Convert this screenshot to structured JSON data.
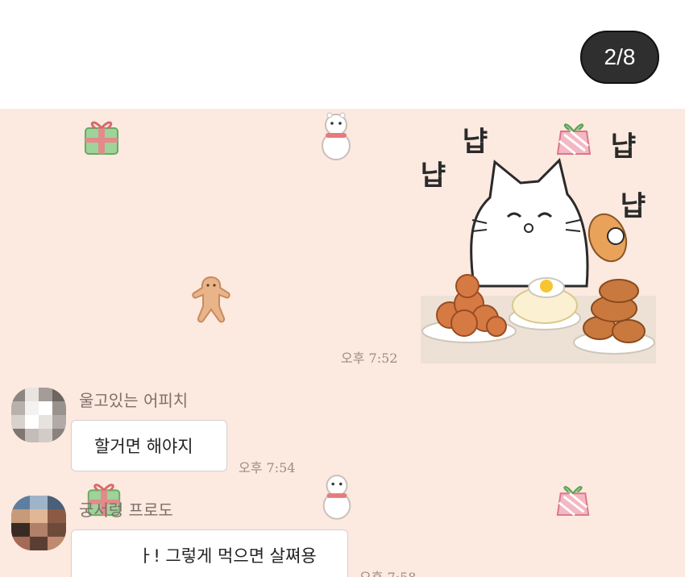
{
  "viewer": {
    "page_counter": "2/8"
  },
  "sticker": {
    "sound_texts": [
      "냡",
      "냡",
      "냡",
      "냡"
    ],
    "time": "오후 7:52"
  },
  "messages": [
    {
      "sender": "울고있는 어피치",
      "text": "할거면 해야지",
      "time": "오후 7:54"
    },
    {
      "sender": "궁서렁 프로도",
      "text": "ㅏ! 그렇게 먹으면 살쪄용",
      "time": "오후 7:58"
    }
  ],
  "colors": {
    "chat_background": "#fce9df",
    "counter_background": "#2f2f2f",
    "bubble": "#ffffff"
  },
  "icons": [
    "gift-icon",
    "snowman-icon",
    "gingerbread-icon",
    "present-icon",
    "cat-sticker"
  ]
}
